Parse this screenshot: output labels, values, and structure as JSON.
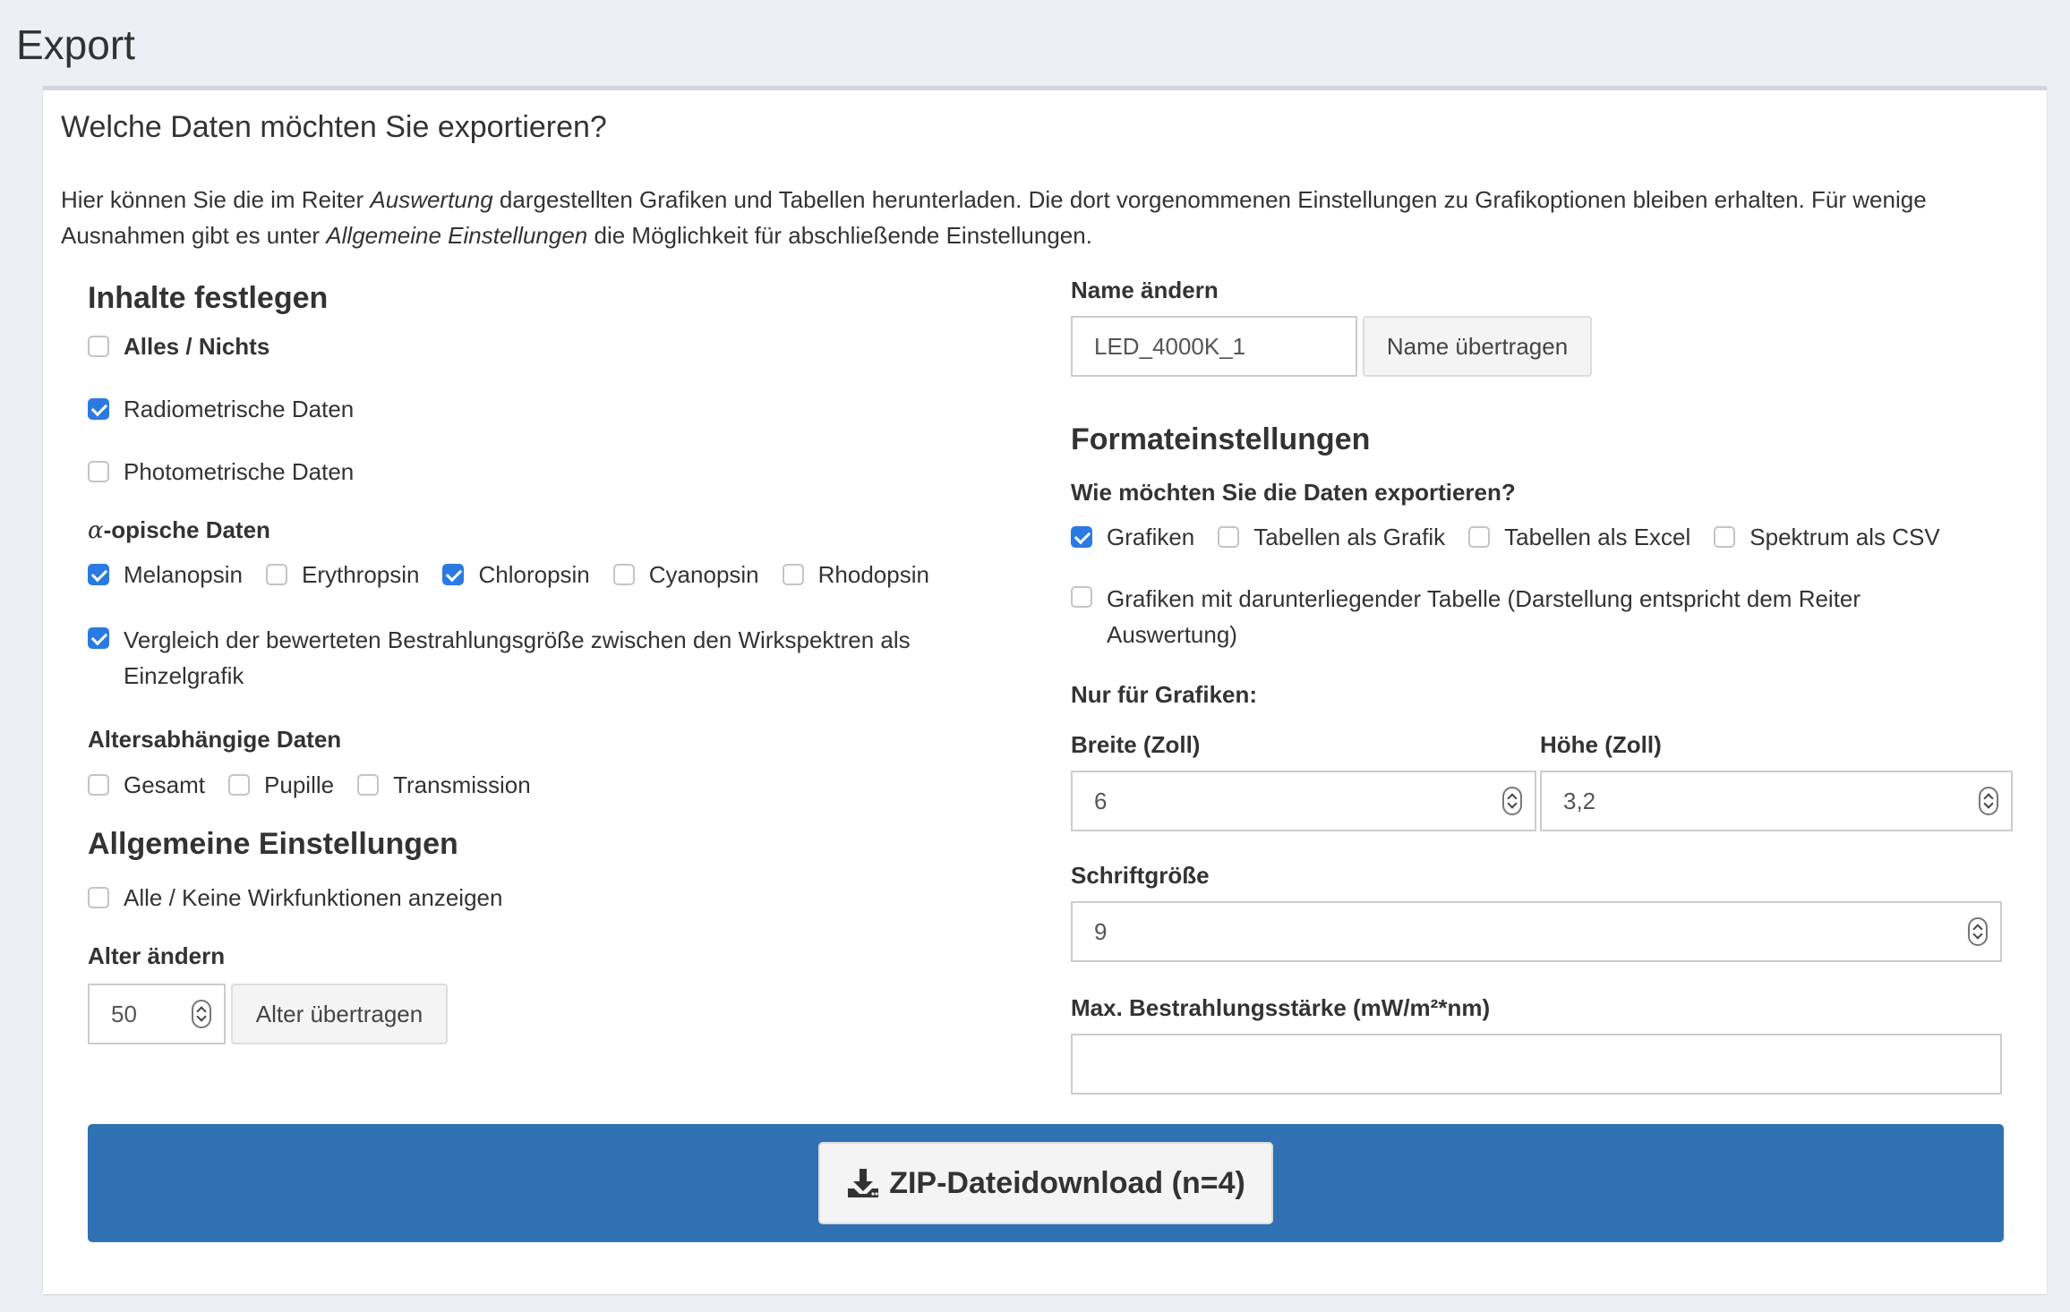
{
  "page": {
    "title": "Export"
  },
  "box": {
    "title": "Welche Daten möchten Sie exportieren?",
    "intro": {
      "part1": "Hier können Sie die im Reiter ",
      "em1": "Auswertung",
      "part2": " dargestellten Grafiken und Tabellen herunterladen. Die dort vorgenommenen Einstellungen zu Grafikoptionen bleiben erhalten. Für wenige Ausnahmen gibt es unter ",
      "em2": "Allgemeine Einstellungen",
      "part3": " die Möglichkeit für abschließende Einstellungen."
    }
  },
  "left": {
    "contents_heading": "Inhalte festlegen",
    "all_none": {
      "label": "Alles / Nichts",
      "checked": false
    },
    "radiometric": {
      "label": "Radiometrische Daten",
      "checked": true
    },
    "photometric": {
      "label": "Photometrische Daten",
      "checked": false
    },
    "alpha_label_symbol": "α",
    "alpha_label_rest": "-opische Daten",
    "alpha_items": [
      {
        "label": "Melanopsin",
        "checked": true
      },
      {
        "label": "Erythropsin",
        "checked": false
      },
      {
        "label": "Chloropsin",
        "checked": true
      },
      {
        "label": "Cyanopsin",
        "checked": false
      },
      {
        "label": "Rhodopsin",
        "checked": false
      }
    ],
    "comparison": {
      "label": "Vergleich der bewerteten Bestrahlungsgröße zwischen den Wirkspektren als Einzelgrafik",
      "checked": true
    },
    "age_label": "Altersabhängige Daten",
    "age_items": [
      {
        "label": "Gesamt",
        "checked": false
      },
      {
        "label": "Pupille",
        "checked": false
      },
      {
        "label": "Transmission",
        "checked": false
      }
    ],
    "general_heading": "Allgemeine Einstellungen",
    "all_functions": {
      "label": "Alle / Keine Wirkfunktionen anzeigen",
      "checked": false
    },
    "age_change_label": "Alter ändern",
    "age_value": "50",
    "age_button": "Alter übertragen"
  },
  "right": {
    "name_label": "Name ändern",
    "name_value": "LED_4000K_1",
    "name_button": "Name übertragen",
    "format_heading": "Formateinstellungen",
    "format_question": "Wie möchten Sie die Daten exportieren?",
    "format_items": [
      {
        "label": "Grafiken",
        "checked": true
      },
      {
        "label": "Tabellen als Grafik",
        "checked": false
      },
      {
        "label": "Tabellen als Excel",
        "checked": false
      },
      {
        "label": "Spektrum als CSV",
        "checked": false
      }
    ],
    "graphics_with_table": {
      "label": "Grafiken mit darunterliegender Tabelle (Darstellung entspricht dem Reiter Auswertung)",
      "checked": false
    },
    "graphics_only_label": "Nur für Grafiken:",
    "width_label": "Breite (Zoll)",
    "width_value": "6",
    "height_label": "Höhe (Zoll)",
    "height_value": "3,2",
    "font_size_label": "Schriftgröße",
    "font_size_value": "9",
    "max_irradiance_label": "Max. Bestrahlungsstärke (mW/m²*nm)",
    "max_irradiance_value": ""
  },
  "download": {
    "label": "ZIP-Dateidownload (n=4)",
    "icon": "download-icon"
  },
  "colors": {
    "primary": "#3071b4",
    "checkbox": "#2a7ae2",
    "background": "#eceff3"
  }
}
